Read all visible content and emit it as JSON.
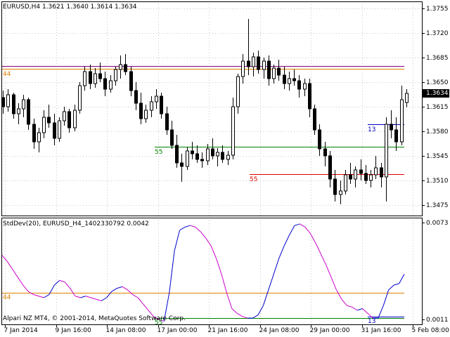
{
  "main_title": "EURUSD,H4  1.3621 1.3640 1.3614 1.3634",
  "indicator_title": "StdDev(20), EURUSD_H4_1402330792 0.0042",
  "copyright": "Alpari NZ MT4, © 2001-2014, MetaQuotes Software Corp.",
  "colors": {
    "background": "#ffffff",
    "grid": "#c8c8c8",
    "axis": "#000000",
    "candle": "#000000",
    "purple_level": "#800080",
    "orange_level": "#e08000",
    "green_level": "#008000",
    "red_level": "#e00000",
    "blue_level": "#0000c0",
    "stddev_up": "#0000cc",
    "stddev_down": "#cc00cc",
    "price_marker_bg": "#000000",
    "price_marker_text": "#ffffff"
  },
  "chart_data": [
    {
      "type": "candlestick",
      "title": "EURUSD,H4  1.3621 1.3640 1.3614 1.3634",
      "ylim": [
        1.346,
        1.3765
      ],
      "y_ticks": [
        "1.3755",
        "1.3720",
        "1.3685",
        "1.3650",
        "1.3615",
        "1.3580",
        "1.3545",
        "1.3510",
        "1.3475"
      ],
      "current_price": "1.3634",
      "x_ticks": [
        "7 Jan 2014",
        "9 Jan 16:00",
        "14 Jan 08:00",
        "17 Jan 00:00",
        "21 Jan 16:00",
        "24 Jan 08:00",
        "29 Jan 00:00",
        "31 Jan 16:00",
        "5 Feb 08:00"
      ],
      "levels": [
        {
          "label": "",
          "value": 1.3673,
          "color": "purple"
        },
        {
          "label": "44",
          "value": 1.3669,
          "color": "orange"
        },
        {
          "label": "55",
          "value": 1.3558,
          "color": "green"
        },
        {
          "label": "55",
          "value": 1.3519,
          "color": "red"
        },
        {
          "label": "13",
          "value": 1.359,
          "color": "blue"
        }
      ],
      "ohlc": [
        [
          1.3628,
          1.3638,
          1.3605,
          1.3615
        ],
        [
          1.3615,
          1.364,
          1.3608,
          1.3632
        ],
        [
          1.3632,
          1.3635,
          1.3598,
          1.3605
        ],
        [
          1.3605,
          1.362,
          1.359,
          1.3612
        ],
        [
          1.3612,
          1.3632,
          1.36,
          1.3625
        ],
        [
          1.3625,
          1.3628,
          1.3582,
          1.359
        ],
        [
          1.359,
          1.3598,
          1.3555,
          1.3565
        ],
        [
          1.3565,
          1.3585,
          1.355,
          1.3578
        ],
        [
          1.3578,
          1.361,
          1.357,
          1.36
        ],
        [
          1.36,
          1.3618,
          1.3585,
          1.3592
        ],
        [
          1.3592,
          1.3605,
          1.356,
          1.357
        ],
        [
          1.357,
          1.36,
          1.3565,
          1.3595
        ],
        [
          1.3595,
          1.3615,
          1.3588,
          1.3608
        ],
        [
          1.3608,
          1.3612,
          1.3578,
          1.3585
        ],
        [
          1.3585,
          1.3618,
          1.358,
          1.361
        ],
        [
          1.361,
          1.365,
          1.3605,
          1.3645
        ],
        [
          1.3645,
          1.3672,
          1.3638,
          1.3665
        ],
        [
          1.3665,
          1.3675,
          1.364,
          1.3648
        ],
        [
          1.3648,
          1.367,
          1.3642,
          1.3662
        ],
        [
          1.3662,
          1.3678,
          1.365,
          1.3655
        ],
        [
          1.3655,
          1.3665,
          1.363,
          1.364
        ],
        [
          1.364,
          1.366,
          1.3635,
          1.3652
        ],
        [
          1.3652,
          1.3672,
          1.3645,
          1.3668
        ],
        [
          1.3668,
          1.3688,
          1.3655,
          1.3675
        ],
        [
          1.3675,
          1.369,
          1.366,
          1.3665
        ],
        [
          1.3665,
          1.3672,
          1.363,
          1.3638
        ],
        [
          1.3638,
          1.365,
          1.361,
          1.362
        ],
        [
          1.362,
          1.3635,
          1.359,
          1.3598
        ],
        [
          1.3598,
          1.3618,
          1.3592,
          1.361
        ],
        [
          1.361,
          1.363,
          1.36,
          1.3622
        ],
        [
          1.3622,
          1.364,
          1.3612,
          1.363
        ],
        [
          1.363,
          1.3635,
          1.3598,
          1.3605
        ],
        [
          1.3605,
          1.3615,
          1.3575,
          1.3582
        ],
        [
          1.3582,
          1.3595,
          1.3555,
          1.356
        ],
        [
          1.356,
          1.3575,
          1.3528,
          1.3535
        ],
        [
          1.3535,
          1.3548,
          1.3508,
          1.353
        ],
        [
          1.353,
          1.3558,
          1.3525,
          1.3552
        ],
        [
          1.3552,
          1.3565,
          1.354,
          1.3548
        ],
        [
          1.3548,
          1.356,
          1.3535,
          1.354
        ],
        [
          1.354,
          1.355,
          1.3528,
          1.3538
        ],
        [
          1.3538,
          1.3562,
          1.3532,
          1.3555
        ],
        [
          1.3555,
          1.357,
          1.354,
          1.3545
        ],
        [
          1.3545,
          1.3556,
          1.353,
          1.355
        ],
        [
          1.355,
          1.356,
          1.3535,
          1.354
        ],
        [
          1.354,
          1.3552,
          1.3532,
          1.3546
        ],
        [
          1.3546,
          1.3628,
          1.354,
          1.3615
        ],
        [
          1.3615,
          1.3662,
          1.3605,
          1.3658
        ],
        [
          1.3658,
          1.369,
          1.3648,
          1.368
        ],
        [
          1.368,
          1.374,
          1.366,
          1.3672
        ],
        [
          1.3672,
          1.3692,
          1.3658,
          1.3686
        ],
        [
          1.3686,
          1.3695,
          1.3662,
          1.3668
        ],
        [
          1.3668,
          1.3685,
          1.3655,
          1.368
        ],
        [
          1.368,
          1.3688,
          1.3645,
          1.3655
        ],
        [
          1.3655,
          1.3675,
          1.3648,
          1.367
        ],
        [
          1.367,
          1.3682,
          1.3652,
          1.366
        ],
        [
          1.366,
          1.3672,
          1.364,
          1.3648
        ],
        [
          1.3648,
          1.3665,
          1.3638,
          1.3655
        ],
        [
          1.3655,
          1.3668,
          1.3645,
          1.3652
        ],
        [
          1.3652,
          1.366,
          1.3628,
          1.364
        ],
        [
          1.364,
          1.3655,
          1.363,
          1.3648
        ],
        [
          1.3648,
          1.3655,
          1.36,
          1.3612
        ],
        [
          1.3612,
          1.3618,
          1.3575,
          1.3582
        ],
        [
          1.3582,
          1.359,
          1.3545,
          1.3555
        ],
        [
          1.3555,
          1.3565,
          1.353,
          1.3545
        ],
        [
          1.3545,
          1.3552,
          1.35,
          1.3512
        ],
        [
          1.3512,
          1.3525,
          1.348,
          1.349
        ],
        [
          1.349,
          1.351,
          1.3476,
          1.3495
        ],
        [
          1.3495,
          1.3525,
          1.349,
          1.3518
        ],
        [
          1.3518,
          1.3535,
          1.3505,
          1.3512
        ],
        [
          1.3512,
          1.353,
          1.35,
          1.3525
        ],
        [
          1.3525,
          1.354,
          1.351,
          1.352
        ],
        [
          1.352,
          1.3532,
          1.3505,
          1.351
        ],
        [
          1.351,
          1.3525,
          1.35,
          1.3518
        ],
        [
          1.3518,
          1.3545,
          1.3512,
          1.3528
        ],
        [
          1.3528,
          1.3535,
          1.35,
          1.3515
        ],
        [
          1.3515,
          1.36,
          1.348,
          1.359
        ],
        [
          1.359,
          1.361,
          1.357,
          1.3582
        ],
        [
          1.3582,
          1.36,
          1.3552,
          1.3565
        ],
        [
          1.3565,
          1.3645,
          1.356,
          1.3625
        ],
        [
          1.3621,
          1.364,
          1.3614,
          1.3634
        ]
      ]
    },
    {
      "type": "line",
      "title": "StdDev(20), EURUSD_H4_1402330792 0.0042",
      "ylim": [
        0.0008,
        0.0076
      ],
      "y_ticks": [
        "0.0073",
        "0.0011"
      ],
      "levels": [
        {
          "label": "44",
          "value": 0.0028,
          "color": "orange"
        },
        {
          "label": "55",
          "value": 0.0012,
          "color": "green"
        },
        {
          "label": "13",
          "value": 0.0013,
          "color": "blue"
        }
      ],
      "values": [
        0.0052,
        0.0048,
        0.0043,
        0.0038,
        0.0033,
        0.0029,
        0.0027,
        0.0026,
        0.0025,
        0.0027,
        0.0033,
        0.0036,
        0.0035,
        0.0031,
        0.0026,
        0.0025,
        0.0026,
        0.0025,
        0.0024,
        0.0023,
        0.0025,
        0.0029,
        0.0031,
        0.0032,
        0.003,
        0.0027,
        0.0025,
        0.0021,
        0.0017,
        0.0013,
        0.0011,
        0.001,
        0.0028,
        0.0055,
        0.0068,
        0.007,
        0.0071,
        0.007,
        0.0067,
        0.0063,
        0.0058,
        0.005,
        0.004,
        0.0028,
        0.0018,
        0.0015,
        0.0013,
        0.0012,
        0.0012,
        0.0014,
        0.002,
        0.003,
        0.004,
        0.005,
        0.0058,
        0.0065,
        0.0071,
        0.0072,
        0.007,
        0.0066,
        0.006,
        0.0053,
        0.0046,
        0.0038,
        0.003,
        0.0024,
        0.002,
        0.0019,
        0.0017,
        0.0018,
        0.0015,
        0.0012,
        0.0012,
        0.002,
        0.003,
        0.0033,
        0.0034,
        0.004
      ]
    }
  ]
}
